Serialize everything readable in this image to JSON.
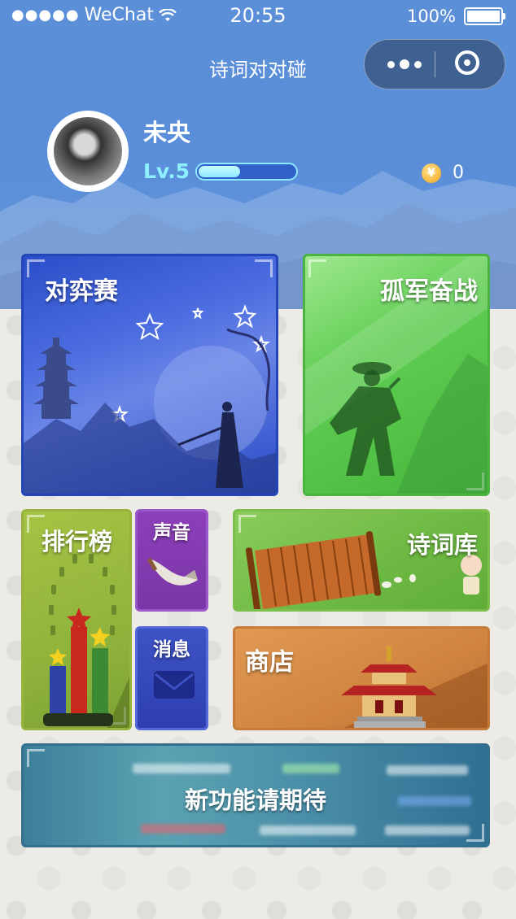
{
  "status_bar": {
    "carrier": "WeChat",
    "time": "20:55",
    "battery": "100%"
  },
  "nav": {
    "title": "诗词对对碰"
  },
  "profile": {
    "username": "未央",
    "level": "Lv.5",
    "xp_progress": 0.45,
    "coins": "0"
  },
  "tiles": {
    "duiyi": "对弈赛",
    "gujun": "孤军奋战",
    "rank": "排行榜",
    "sound": "声音",
    "message": "消息",
    "poem_library": "诗词库",
    "shop": "商店",
    "coming_soon": "新功能请期待"
  },
  "colors": {
    "header_blue": "#5b8fd8",
    "xp_accent": "#8ee6ff",
    "duiyi_blue": "#2b4ec9",
    "gujun_green": "#5fcd52",
    "rank_olive": "#98b33c",
    "sound_purple": "#8c40b8",
    "message_blue": "#3d52c5",
    "poem_green": "#6cb842",
    "shop_orange": "#d08440",
    "new_teal": "#3d7f9a"
  },
  "icons": [
    "wifi-icon",
    "battery-icon",
    "more-icon",
    "close-capsule-icon",
    "coin-icon",
    "horn-icon",
    "envelope-icon",
    "pagoda-icon",
    "warrior-icon",
    "trophy-bars-icon",
    "scroll-icon",
    "temple-icon"
  ]
}
